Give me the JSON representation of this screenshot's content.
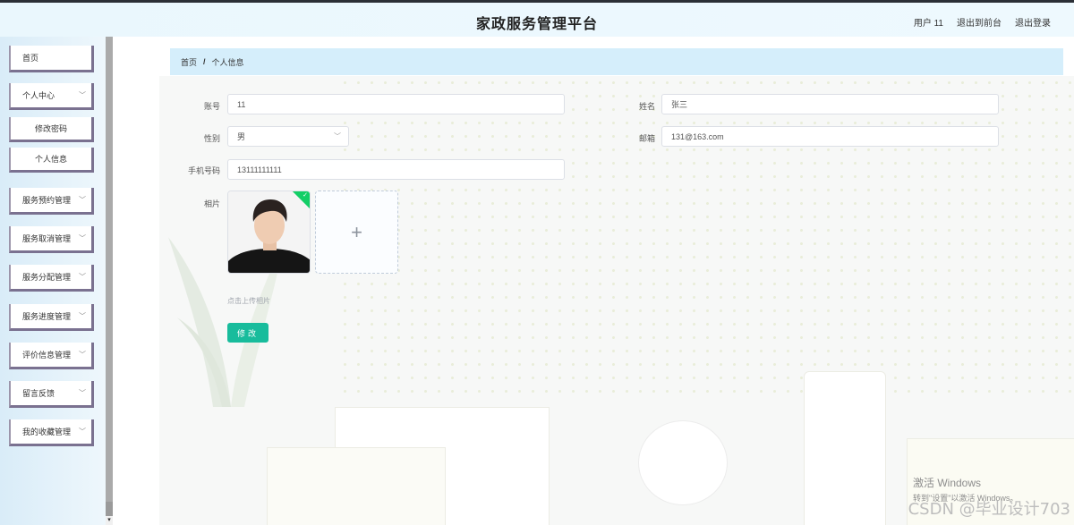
{
  "header": {
    "title": "家政服务管理平台",
    "user_label": "用户 11",
    "back_front_label": "退出到前台",
    "logout_label": "退出登录"
  },
  "sidebar": {
    "items": [
      {
        "label": "首页"
      },
      {
        "label": "个人中心"
      },
      {
        "label": "修改密码"
      },
      {
        "label": "个人信息"
      },
      {
        "label": "服务预约管理"
      },
      {
        "label": "服务取消管理"
      },
      {
        "label": "服务分配管理"
      },
      {
        "label": "服务进度管理"
      },
      {
        "label": "评价信息管理"
      },
      {
        "label": "留言反馈"
      },
      {
        "label": "我的收藏管理"
      }
    ]
  },
  "breadcrumb": {
    "home": "首页",
    "separator": "/",
    "current": "个人信息"
  },
  "form": {
    "account_label": "账号",
    "account_value": "11",
    "name_label": "姓名",
    "name_value": "张三",
    "gender_label": "性别",
    "gender_value": "男",
    "email_label": "邮箱",
    "email_value": "131@163.com",
    "phone_label": "手机号码",
    "phone_value": "13111111111",
    "photo_label": "相片",
    "upload_plus": "+",
    "upload_tip": "点击上传相片",
    "submit_label": "修改"
  },
  "overlay": {
    "activate_windows": "激活 Windows",
    "activate_hint": "转到\"设置\"以激活 Windows。",
    "csdn": "CSDN @毕业设计703"
  },
  "colors": {
    "accent": "#18bc9c",
    "breadcrumb_bg": "#d5eefb",
    "sidebar_border": "#7a7190"
  }
}
